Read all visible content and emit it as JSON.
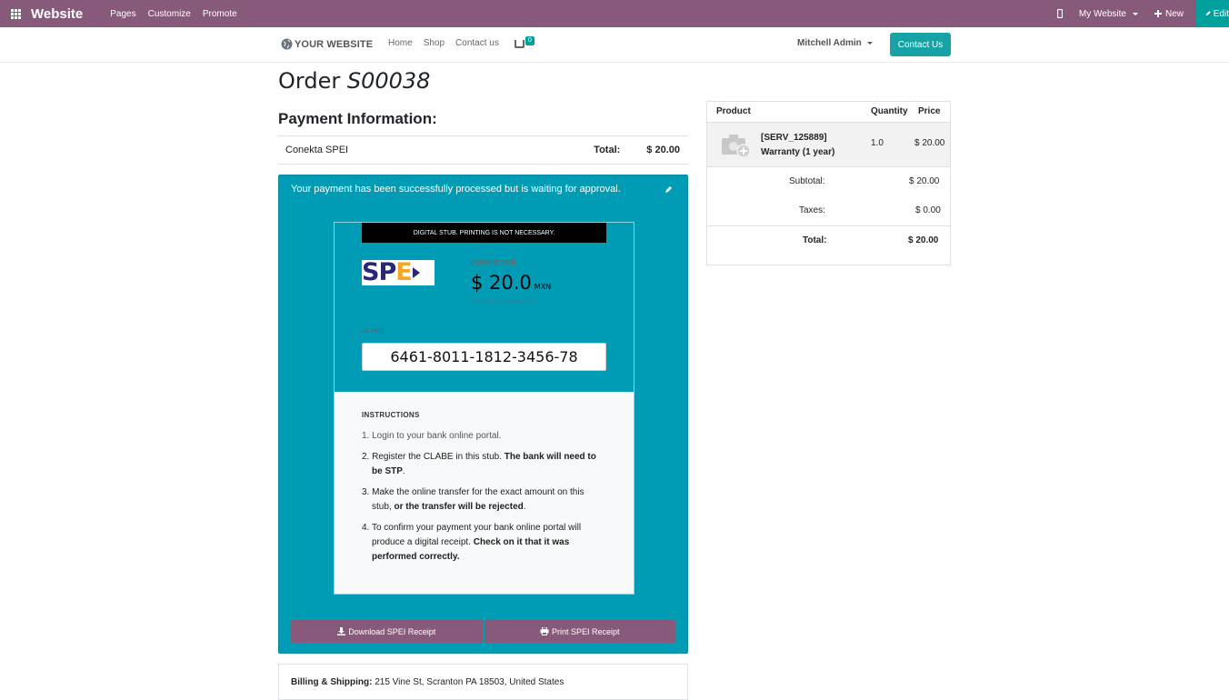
{
  "topbar": {
    "brand": "Website",
    "menu": [
      "Pages",
      "Customize",
      "Promote"
    ],
    "my_website": "My Website",
    "new_label": "New",
    "edit_label": "Edit"
  },
  "navbar": {
    "logo": "YOUR WEBSITE",
    "links": [
      "Home",
      "Shop",
      "Contact us"
    ],
    "cart_count": "0",
    "user": "Mitchell Admin",
    "contact_button": "Contact Us"
  },
  "order": {
    "prefix": "Order",
    "number": "S00038"
  },
  "payment": {
    "heading": "Payment Information:",
    "method": "Conekta SPEI",
    "total_label": "Total:",
    "total_value": "$ 20.00",
    "alert_message": "Your payment has been successfully processed but is waiting for approval."
  },
  "stub": {
    "banner": "DIGITAL STUB. PRINTING IS NOT NECESSARY.",
    "amount_label": "AMOUNT DUE",
    "amount_value": "$ 20.0",
    "currency": "MXN",
    "transfer_note": "Transfer this exact amount.",
    "clabe_label": "CLABE",
    "clabe_value": "6461-8011-1812-3456-78",
    "instructions_title": "INSTRUCTIONS",
    "step1": "1. Login to your bank online portal.",
    "step2_a": "2. Register the CLABE in this stub. ",
    "step2_b": "The bank will need to be STP",
    "step2_c": ".",
    "step3_a": "3. Make the online transfer for the exact amount on this stub, ",
    "step3_b": "or the transfer will be rejected",
    "step3_c": ".",
    "step4_a": "4. To confirm your payment your bank online portal will produce a digital receipt. ",
    "step4_b": "Check on it that it was performed correctly."
  },
  "buttons": {
    "download": "Download SPEI Receipt",
    "print": "Print SPEI Receipt"
  },
  "billing": {
    "label": "Billing & Shipping:",
    "address": " 215 Vine St, Scranton PA 18503, United States"
  },
  "summary": {
    "headers": [
      "Product",
      "Quantity",
      "Price"
    ],
    "item_code": "[SERV_125889]",
    "item_name": "Warranty (1 year)",
    "item_qty": "1.0",
    "item_price": "$ 20.00",
    "subtotal_label": "Subtotal:",
    "subtotal_value": "$ 20.00",
    "taxes_label": "Taxes:",
    "taxes_value": "$ 0.00",
    "total_label": "Total:",
    "total_value": "$ 20.00"
  },
  "colors": {
    "odoo_purple": "#875A7B",
    "teal": "#009BB5",
    "contact_teal": "#17A2A6",
    "edit_teal": "#00A09D"
  },
  "icons": [
    "apps-grid-icon",
    "mobile-icon",
    "plus-icon",
    "pencil-icon",
    "globe-icon",
    "cart-icon",
    "camera-icon",
    "download-icon",
    "print-icon"
  ]
}
